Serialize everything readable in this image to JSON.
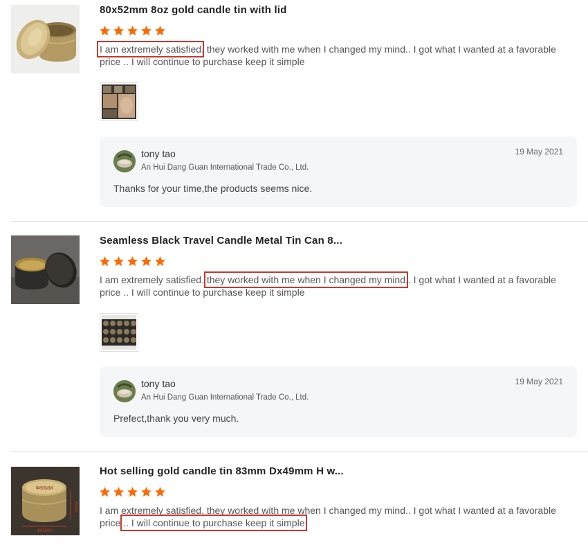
{
  "reviews": [
    {
      "product_title": "80x52mm 8oz gold candle tin with lid",
      "rating": 5,
      "text_parts": [
        "I am extremely satisfied",
        ". they worked with me when I changed my mind",
        ".. I got what I wanted at a favorable price ",
        ".. I will continue to purchase keep it simple"
      ],
      "reply": {
        "name": "tony tao",
        "company": "An Hui Dang Guan International Trade Co., Ltd.",
        "date": "19 May 2021",
        "text": "Thanks for your time,the products seems nice."
      }
    },
    {
      "product_title": "Seamless Black Travel Candle Metal Tin Can 8...",
      "rating": 5,
      "text_parts": [
        "I am extremely satisfied",
        ". they worked with me when I changed my mind",
        ".. I got what I wanted at a favorable price ",
        ".. I will continue to purchase keep it simple"
      ],
      "reply": {
        "name": "tony tao",
        "company": "An Hui Dang Guan International Trade Co., Ltd.",
        "date": "19 May 2021",
        "text": "Prefect,thank you very much."
      }
    },
    {
      "product_title": "Hot selling gold candle tin 83mm Dx49mm H w...",
      "rating": 5,
      "text_parts": [
        "I am extremely satisfied",
        ". they worked with me when I changed my mind",
        ".. I got what I wanted at a favorable price ",
        ".. I will continue to purchase keep it simple"
      ],
      "product_image_labels": [
        "Φ80MM",
        "49MM",
        "Φ83MM"
      ]
    }
  ],
  "colors": {
    "star": "#ff6a00",
    "highlight_box": "#c8372d",
    "reply_bg": "#f5f6f8"
  }
}
